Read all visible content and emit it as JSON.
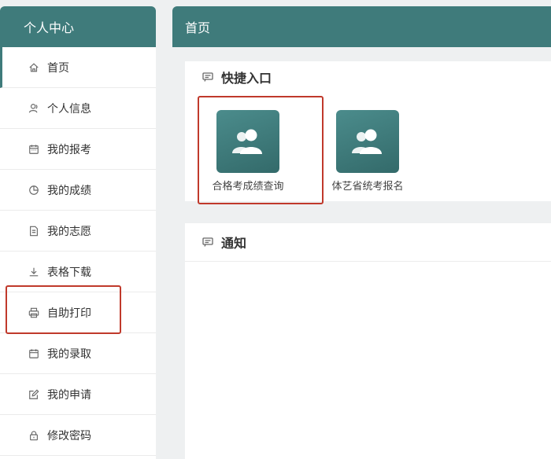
{
  "sidebar": {
    "title": "个人中心",
    "items": [
      {
        "label": "首页",
        "icon": "home-icon"
      },
      {
        "label": "个人信息",
        "icon": "user-icon"
      },
      {
        "label": "我的报考",
        "icon": "calendar-icon"
      },
      {
        "label": "我的成绩",
        "icon": "pie-chart-icon"
      },
      {
        "label": "我的志愿",
        "icon": "document-icon"
      },
      {
        "label": "表格下载",
        "icon": "download-icon"
      },
      {
        "label": "自助打印",
        "icon": "printer-icon"
      },
      {
        "label": "我的录取",
        "icon": "calendar-check-icon"
      },
      {
        "label": "我的申请",
        "icon": "edit-icon"
      },
      {
        "label": "修改密码",
        "icon": "lock-icon"
      }
    ]
  },
  "main": {
    "header_title": "首页",
    "quick_entry": {
      "title": "快捷入口",
      "items": [
        {
          "label": "合格考成绩查询",
          "icon": "users-icon"
        },
        {
          "label": "体艺省统考报名",
          "icon": "users-icon"
        }
      ]
    },
    "notice": {
      "title": "通知"
    }
  },
  "colors": {
    "accent": "#3f7b7b",
    "highlight": "#c0392b"
  }
}
